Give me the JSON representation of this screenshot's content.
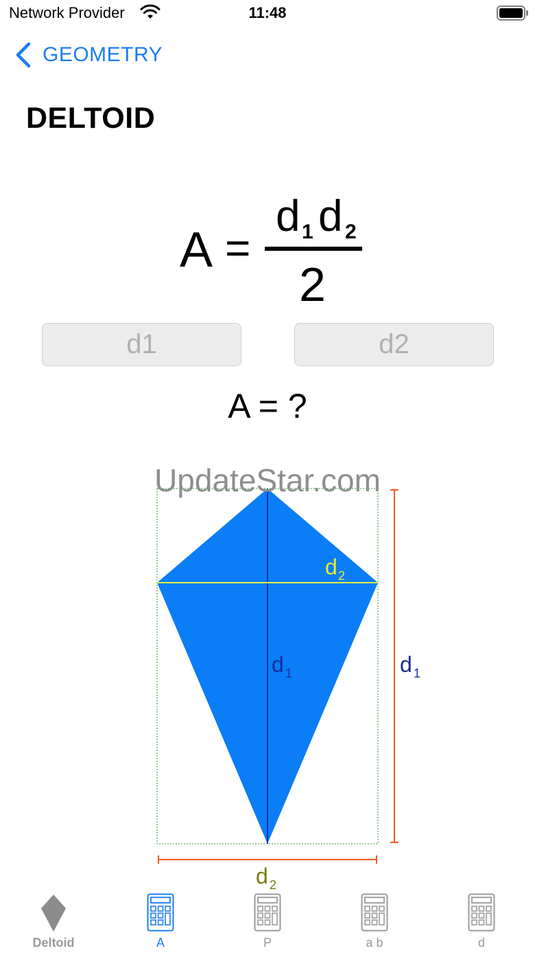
{
  "status_bar": {
    "carrier": "Network Provider",
    "time": "11:48",
    "icons": [
      "wifi-icon",
      "battery-icon"
    ]
  },
  "nav": {
    "back_label": "GEOMETRY",
    "back_icon": "chevron-left-icon"
  },
  "page": {
    "title": "DELTOID"
  },
  "formula": {
    "lhs": "A",
    "equals": "=",
    "numerator_1": "d",
    "numerator_1_sub": "1",
    "numerator_2": "d",
    "numerator_2_sub": "2",
    "denominator": "2"
  },
  "inputs": {
    "d1_placeholder": "d1",
    "d2_placeholder": "d2"
  },
  "result": {
    "text": "A = ?"
  },
  "watermark": "UpdateStar.com",
  "diagram": {
    "labels": {
      "d2_inner": "d",
      "d2_inner_sub": "2",
      "d1_inner": "d",
      "d1_inner_sub": "1",
      "d1_outer": "d",
      "d1_outer_sub": "1",
      "d2_outer": "d",
      "d2_outer_sub": "2"
    },
    "colors": {
      "kite": "#0a7df7",
      "d1_line": "#1c2fa0",
      "d2_line": "#e6f03c",
      "d2_label": "#e8ee2c",
      "d1_label": "#1a2c9c",
      "dimension": "#ef5a1c",
      "d2_outer_label": "#7a7a10",
      "guide": "#2e9a2e"
    }
  },
  "tabs": [
    {
      "label": "Deltoid",
      "icon": "deltoid-icon",
      "active": false
    },
    {
      "label": "A",
      "icon": "calculator-icon",
      "active": true
    },
    {
      "label": "P",
      "icon": "calculator-icon",
      "active": false
    },
    {
      "label": "a b",
      "icon": "calculator-icon",
      "active": false
    },
    {
      "label": "d",
      "icon": "calculator-icon",
      "active": false
    }
  ],
  "accent_color": "#1a7df2"
}
